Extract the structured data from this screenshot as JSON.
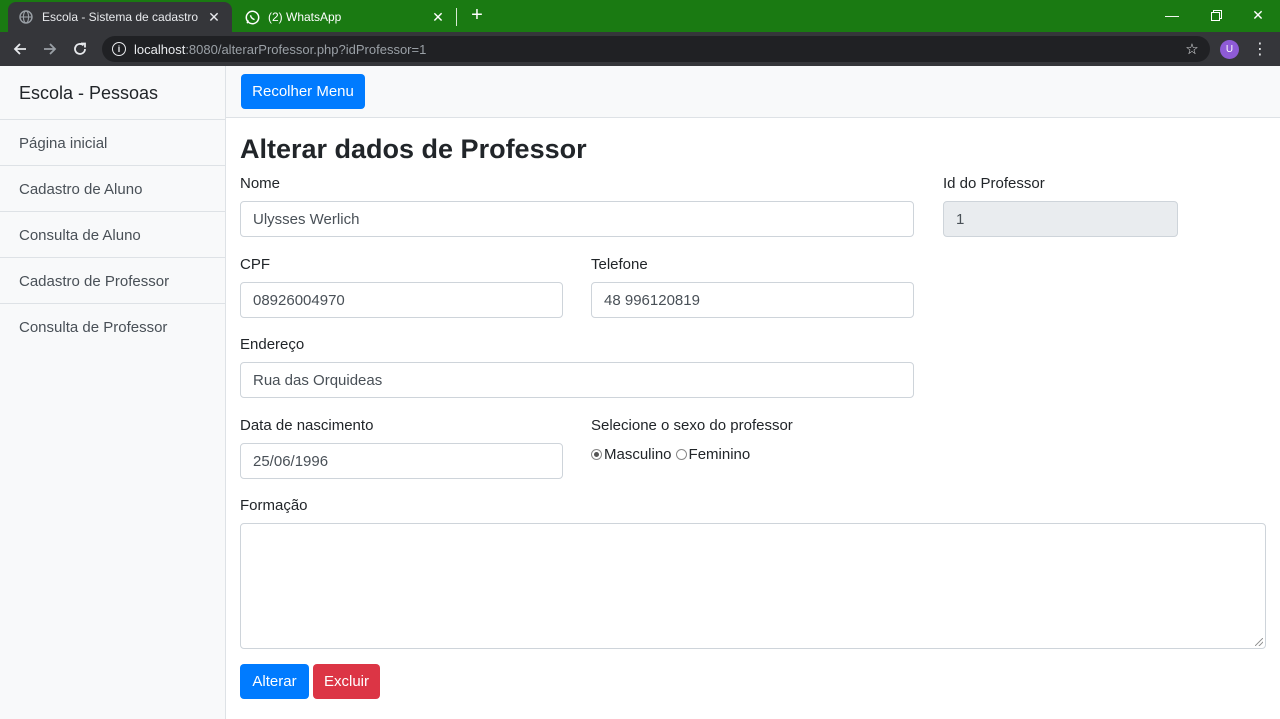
{
  "browser": {
    "tabs": [
      {
        "title": "Escola - Sistema de cadastro",
        "active": true,
        "favicon": "globe-icon"
      },
      {
        "title": "(2) WhatsApp",
        "active": false,
        "favicon": "whatsapp-icon"
      }
    ],
    "url_host": "localhost",
    "url_rest": ":8080/alterarProfessor.php?idProfessor=1",
    "avatar_letter": "U",
    "colors": {
      "tabbar": "#1a7a12",
      "toolbar": "#35363a"
    }
  },
  "sidebar": {
    "heading": "Escola - Pessoas",
    "items": [
      {
        "label": "Página inicial"
      },
      {
        "label": "Cadastro de Aluno"
      },
      {
        "label": "Consulta de Aluno"
      },
      {
        "label": "Cadastro de Professor"
      },
      {
        "label": "Consulta de Professor"
      }
    ]
  },
  "topnav": {
    "menu_toggle_label": "Recolher Menu"
  },
  "form": {
    "title": "Alterar dados de Professor",
    "nome": {
      "label": "Nome",
      "value": "Ulysses Werlich"
    },
    "id": {
      "label": "Id do Professor",
      "value": "1"
    },
    "cpf": {
      "label": "CPF",
      "value": "08926004970"
    },
    "telefone": {
      "label": "Telefone",
      "value": "48 996120819"
    },
    "endereco": {
      "label": "Endereço",
      "value": "Rua das Orquideas"
    },
    "nascimento": {
      "label": "Data de nascimento",
      "value": "25/06/1996"
    },
    "sexo": {
      "label": "Selecione o sexo do professor",
      "options": [
        {
          "label": "Masculino",
          "checked": true
        },
        {
          "label": "Feminino",
          "checked": false
        }
      ]
    },
    "formacao": {
      "label": "Formação",
      "value": ""
    },
    "submit_label": "Alterar",
    "delete_label": "Excluir"
  },
  "colors": {
    "primary": "#007bff",
    "danger": "#dc3545"
  }
}
